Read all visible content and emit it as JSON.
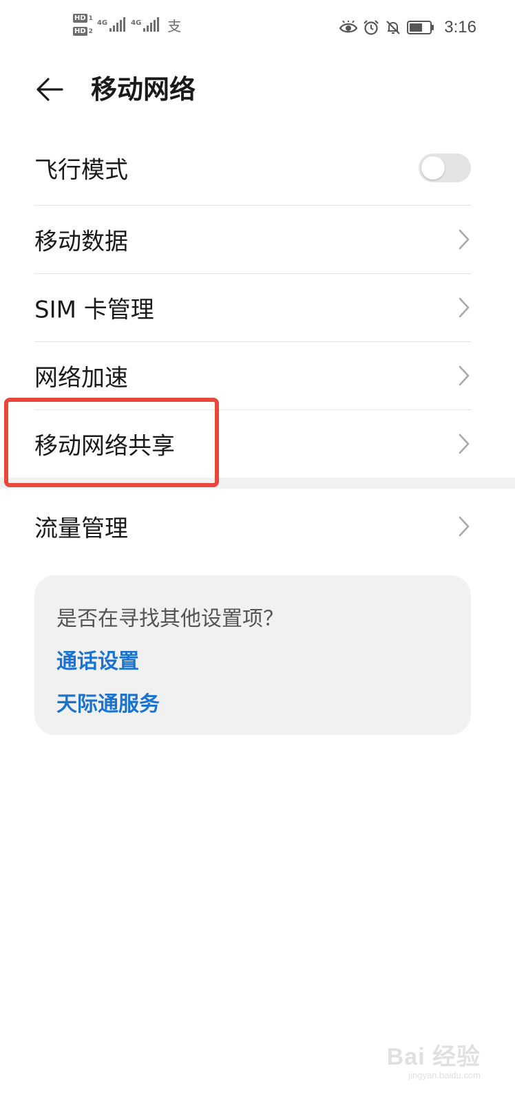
{
  "status_bar": {
    "hd1": "HD",
    "hd1_num": "1",
    "hd2": "HD",
    "hd2_num": "2",
    "net1": "4G",
    "net2": "4G",
    "alipay": "支",
    "time": "3:16"
  },
  "header": {
    "title": "移动网络"
  },
  "settings": {
    "airplane_mode": {
      "label": "飞行模式",
      "enabled": false
    },
    "items": [
      {
        "label": "移动数据"
      },
      {
        "label": "SIM 卡管理"
      },
      {
        "label": "网络加速"
      },
      {
        "label": "移动网络共享"
      },
      {
        "label": "流量管理"
      }
    ]
  },
  "suggestions": {
    "title": "是否在寻找其他设置项？",
    "links": [
      {
        "label": "通话设置"
      },
      {
        "label": "天际通服务"
      }
    ]
  },
  "watermark": {
    "main": "Bai 经验",
    "sub": "jingyan.baidu.com"
  },
  "colors": {
    "accent_link": "#1a73d1",
    "highlight": "#e8483b",
    "toggle_off": "#e4e4e4",
    "card_bg": "#f1f1f1"
  }
}
